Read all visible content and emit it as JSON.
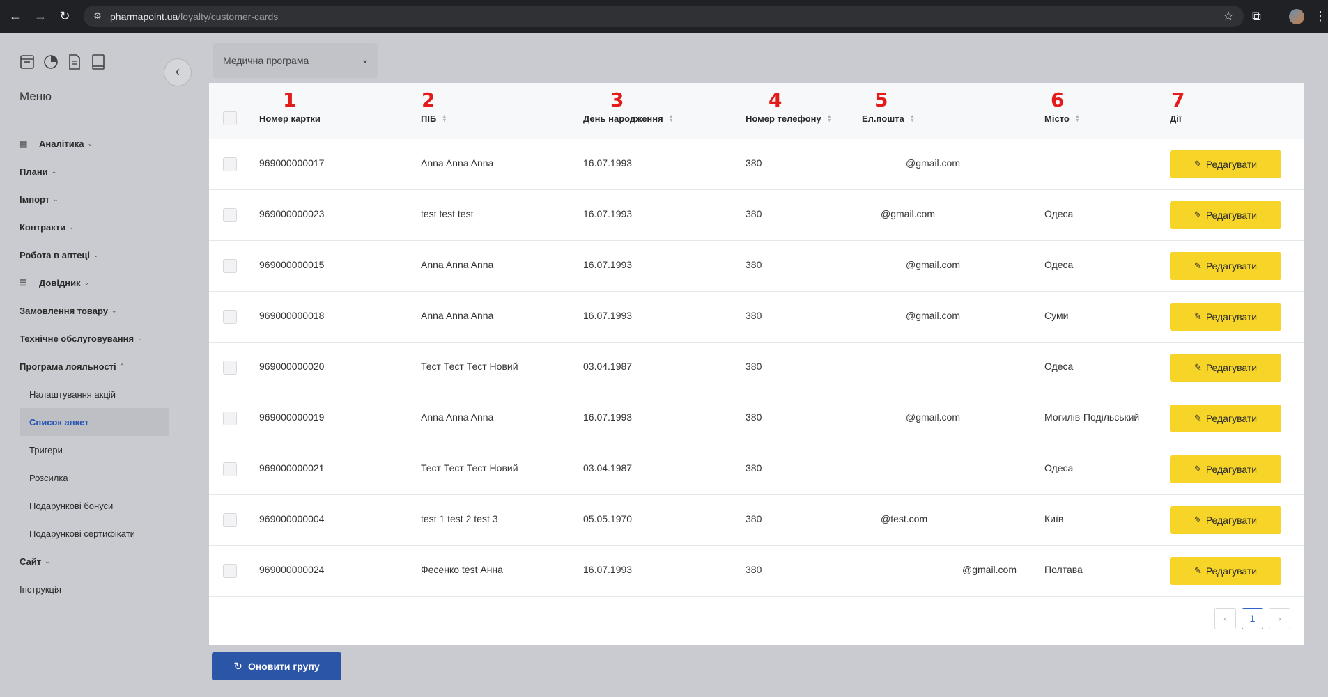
{
  "browser": {
    "url_domain": "pharmapoint.ua",
    "url_path": "/loyalty/customer-cards"
  },
  "sidebar": {
    "menu_title": "Меню",
    "items": [
      {
        "label": "Аналітика",
        "icon": "grid-icon"
      },
      {
        "label": "Плани"
      },
      {
        "label": "Імпорт"
      },
      {
        "label": "Контракти"
      },
      {
        "label": "Робота в аптеці"
      },
      {
        "label": "Довідник",
        "icon": "list-icon"
      },
      {
        "label": "Замовлення товару"
      },
      {
        "label": "Технічне обслуговування"
      },
      {
        "label": "Програма лояльності"
      }
    ],
    "loyalty_subitems": [
      "Налаштування акцій",
      "Список анкет",
      "Тригери",
      "Розсилка",
      "Подарункові бонуси",
      "Подарункові сертифікати"
    ],
    "after_items": [
      "Сайт",
      "Інструкція"
    ]
  },
  "program_select": {
    "value": "Медична програма"
  },
  "table": {
    "column_numbers": [
      "1",
      "2",
      "3",
      "4",
      "5",
      "6",
      "7"
    ],
    "headers": {
      "card_number": "Номер картки",
      "name": "ПІБ",
      "birthday": "День народження",
      "phone": "Номер телефону",
      "email": "Ел.пошта",
      "city": "Місто",
      "actions": "Дії"
    },
    "edit_label": "Редагувати",
    "rows": [
      {
        "card": "969000000017",
        "name": "Anna Anna Anna",
        "birthday": "16.07.1993",
        "phone": "380",
        "email": "@gmail.com",
        "city": ""
      },
      {
        "card": "969000000023",
        "name": "test test test",
        "birthday": "16.07.1993",
        "phone": "380",
        "email": "@gmail.com",
        "city": "Одеса"
      },
      {
        "card": "969000000015",
        "name": "Anna Anna Anna",
        "birthday": "16.07.1993",
        "phone": "380",
        "email": "@gmail.com",
        "city": "Одеса"
      },
      {
        "card": "969000000018",
        "name": "Anna Anna Anna",
        "birthday": "16.07.1993",
        "phone": "380",
        "email": "@gmail.com",
        "city": "Суми"
      },
      {
        "card": "969000000020",
        "name": "Тест Тест Тест Новий",
        "birthday": "03.04.1987",
        "phone": "380",
        "email": "",
        "city": "Одеса"
      },
      {
        "card": "969000000019",
        "name": "Anna Anna Anna",
        "birthday": "16.07.1993",
        "phone": "380",
        "email": "@gmail.com",
        "city": "Могилів-Подільський"
      },
      {
        "card": "969000000021",
        "name": "Тест Тест Тест Новий",
        "birthday": "03.04.1987",
        "phone": "380",
        "email": "",
        "city": "Одеса"
      },
      {
        "card": "969000000004",
        "name": "test 1 test 2 test 3",
        "birthday": "05.05.1970",
        "phone": "380",
        "email": "@test.com",
        "city": "Київ"
      },
      {
        "card": "969000000024",
        "name": "Фесенко test Анна",
        "birthday": "16.07.1993",
        "phone": "380",
        "email": "@gmail.com",
        "city": "Полтава"
      }
    ]
  },
  "pagination": {
    "prev": "‹",
    "current": "1",
    "next": "›"
  },
  "refresh_button": "Оновити групу"
}
